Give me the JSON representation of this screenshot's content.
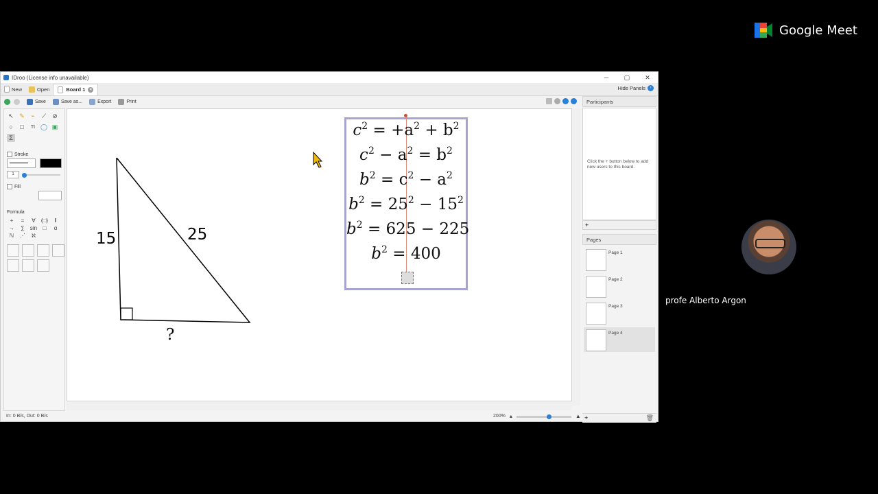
{
  "meet": {
    "brand": "Google Meet",
    "participant_name": "profe Alberto Argon"
  },
  "window": {
    "title": "IDroo (License info unavailable)",
    "controls": [
      "─",
      "▢",
      "✕"
    ]
  },
  "tabbar": {
    "new_label": "New",
    "open_label": "Open",
    "tab_label": "Board 1",
    "hide_panels_label": "Hide Panels"
  },
  "toolbar": {
    "save_label": "Save",
    "saveas_label": "Save as...",
    "export_label": "Export",
    "print_label": "Print"
  },
  "leftpanel": {
    "stroke_label": "Stroke",
    "fill_label": "Fill",
    "formula_label": "Formula",
    "stroke_width_value": "1"
  },
  "formula_symbols": [
    "+",
    "=",
    "∀",
    "(□)",
    "‖",
    "→",
    "∑",
    "sin",
    "□",
    "α",
    "ℕ",
    "⋰",
    "ℵ"
  ],
  "canvas": {
    "side_left": "15",
    "side_hyp": "25",
    "side_bottom": "?"
  },
  "formulas": [
    {
      "base": "c",
      "exp": "2",
      "rest_a": " = +a",
      "exp2": "2",
      "rest_b": " + b",
      "exp3": "2"
    },
    {
      "base": "c",
      "exp": "2",
      "rest_a": " − a",
      "exp2": "2",
      "rest_b": " = b",
      "exp3": "2"
    },
    {
      "base": "b",
      "exp": "2",
      "rest_a": " = c",
      "exp2": "2",
      "rest_b": " − a",
      "exp3": "2"
    },
    {
      "base": "b",
      "exp": "2",
      "rest_a": " = 25",
      "exp2": "2",
      "rest_b": " − 15",
      "exp3": "2"
    },
    {
      "base": "b",
      "exp": "2",
      "rest_a": " = 625 − 225",
      "exp2": "",
      "rest_b": "",
      "exp3": ""
    },
    {
      "base": "b",
      "exp": "2",
      "rest_a": " = 400",
      "exp2": "",
      "rest_b": "",
      "exp3": ""
    }
  ],
  "rightpanel": {
    "participants_title": "Participants",
    "participants_hint": "Click the + button below to add new users to this board.",
    "pages_title": "Pages",
    "pages": [
      "Page 1",
      "Page 2",
      "Page 3",
      "Page 4"
    ],
    "active_page": "Page 4"
  },
  "status": {
    "io": "In: 0 B/s, Out: 0 B/s",
    "zoom": "200%"
  },
  "colors": {
    "selection_border": "#a8a4d1",
    "accent": "#2a7fd6"
  }
}
